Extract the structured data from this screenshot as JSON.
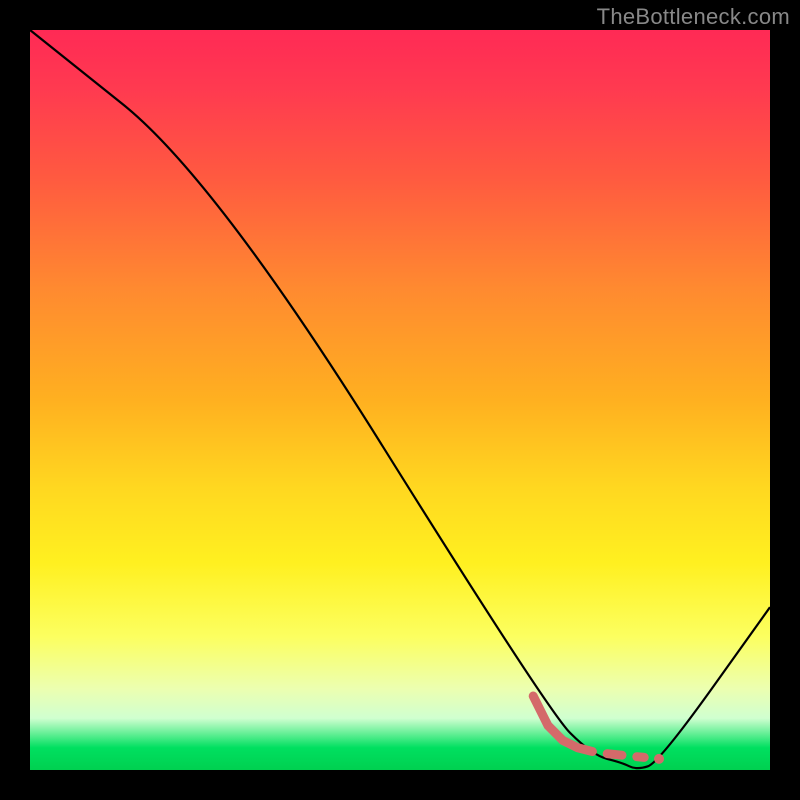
{
  "watermark": "TheBottleneck.com",
  "chart_data": {
    "type": "line",
    "title": "",
    "xlabel": "",
    "ylabel": "",
    "xlim": [
      0,
      100
    ],
    "ylim": [
      0,
      100
    ],
    "series": [
      {
        "name": "main-curve",
        "x": [
          0,
          25,
          70,
          76,
          80,
          82,
          85,
          100
        ],
        "values": [
          100,
          80,
          8,
          2,
          1,
          0,
          1,
          22
        ],
        "stroke": "#000000",
        "width": 2.2
      },
      {
        "name": "highlight-segment",
        "x": [
          68,
          70,
          72,
          74,
          76
        ],
        "values": [
          10,
          6,
          4,
          3,
          2.5
        ],
        "stroke": "#d46a6a",
        "width": 9
      }
    ],
    "dash_segments": [
      {
        "x": [
          78,
          80
        ],
        "values": [
          2.2,
          2.0
        ],
        "stroke": "#d46a6a",
        "width": 9
      },
      {
        "x": [
          82,
          83
        ],
        "values": [
          1.8,
          1.7
        ],
        "stroke": "#d46a6a",
        "width": 9
      }
    ],
    "points": [
      {
        "x": 85,
        "y": 1.5,
        "r": 5,
        "fill": "#d46a6a"
      }
    ],
    "gradient_stops": [
      {
        "pct": 0,
        "color": "#ff2a55"
      },
      {
        "pct": 35,
        "color": "#ff8a30"
      },
      {
        "pct": 62,
        "color": "#ffd820"
      },
      {
        "pct": 82,
        "color": "#fcff60"
      },
      {
        "pct": 97,
        "color": "#00e060"
      },
      {
        "pct": 100,
        "color": "#00d050"
      }
    ]
  }
}
